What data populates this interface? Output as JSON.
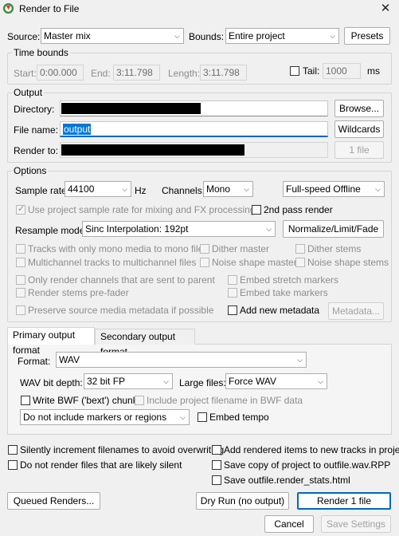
{
  "window": {
    "title": "Render to File",
    "close_glyph": "✕"
  },
  "source": {
    "label": "Source:",
    "value": "Master mix"
  },
  "bounds": {
    "label": "Bounds:",
    "value": "Entire project"
  },
  "presets_button": "Presets",
  "time_bounds": {
    "group_label": "Time bounds",
    "start_label": "Start:",
    "start_value": "0:00.000",
    "end_label": "End:",
    "end_value": "3:11.798",
    "length_label": "Length:",
    "length_value": "3:11.798",
    "tail_label": "Tail:",
    "tail_value": "1000",
    "tail_unit": "ms"
  },
  "output": {
    "group_label": "Output",
    "directory_label": "Directory:",
    "browse_button": "Browse...",
    "filename_label": "File name:",
    "filename_value": "output",
    "wildcards_button": "Wildcards",
    "render_to_label": "Render to:",
    "file_count_button": "1 file"
  },
  "options": {
    "group_label": "Options",
    "sample_rate_label": "Sample rate:",
    "sample_rate_value": "44100",
    "sample_rate_unit": "Hz",
    "channels_label": "Channels:",
    "channels_value": "Mono",
    "render_speed_value": "Full-speed Offline",
    "use_project_rate": "Use project sample rate for mixing and FX processing",
    "second_pass": "2nd pass render",
    "resample_label": "Resample mode:",
    "resample_value": "Sinc Interpolation: 192pt",
    "normalize_button": "Normalize/Limit/Fade",
    "tracks_mono": "Tracks with only mono media to mono file",
    "multichannel": "Multichannel tracks to multichannel files",
    "dither_master": "Dither master",
    "noise_master": "Noise shape master",
    "dither_stems": "Dither stems",
    "noise_stems": "Noise shape stems",
    "only_parent": "Only render channels that are sent to parent",
    "stems_prefader": "Render stems pre-fader",
    "embed_stretch": "Embed stretch markers",
    "embed_take": "Embed take markers",
    "preserve_metadata": "Preserve source media metadata if possible",
    "add_metadata": "Add new metadata",
    "metadata_button": "Metadata..."
  },
  "tabs": {
    "primary": "Primary output format",
    "secondary": "Secondary output format"
  },
  "format": {
    "label": "Format:",
    "value": "WAV",
    "bit_depth_label": "WAV bit depth:",
    "bit_depth_value": "32 bit FP",
    "large_files_label": "Large files:",
    "large_files_value": "Force WAV",
    "write_bwf": "Write BWF ('bext') chunk",
    "include_filename": "Include project filename in BWF data",
    "markers_value": "Do not include markers or regions",
    "embed_tempo": "Embed tempo"
  },
  "bottom_options": {
    "silently_increment": "Silently increment filenames to avoid overwriting",
    "do_not_render_silent": "Do not render files that are likely silent",
    "add_rendered": "Add rendered items to new tracks in project",
    "save_copy": "Save copy of project to outfile.wav.RPP",
    "save_stats": "Save outfile.render_stats.html"
  },
  "buttons": {
    "queued": "Queued Renders...",
    "dry_run": "Dry Run (no output)",
    "render": "Render 1 file",
    "cancel": "Cancel",
    "save_settings": "Save Settings"
  },
  "colors": {
    "accent": "#0067c0",
    "selection": "#0078d7",
    "redaction": "#000000"
  },
  "icons": [
    "reaper-app-icon",
    "close-icon",
    "chevron-down-icon",
    "checkbox"
  ]
}
